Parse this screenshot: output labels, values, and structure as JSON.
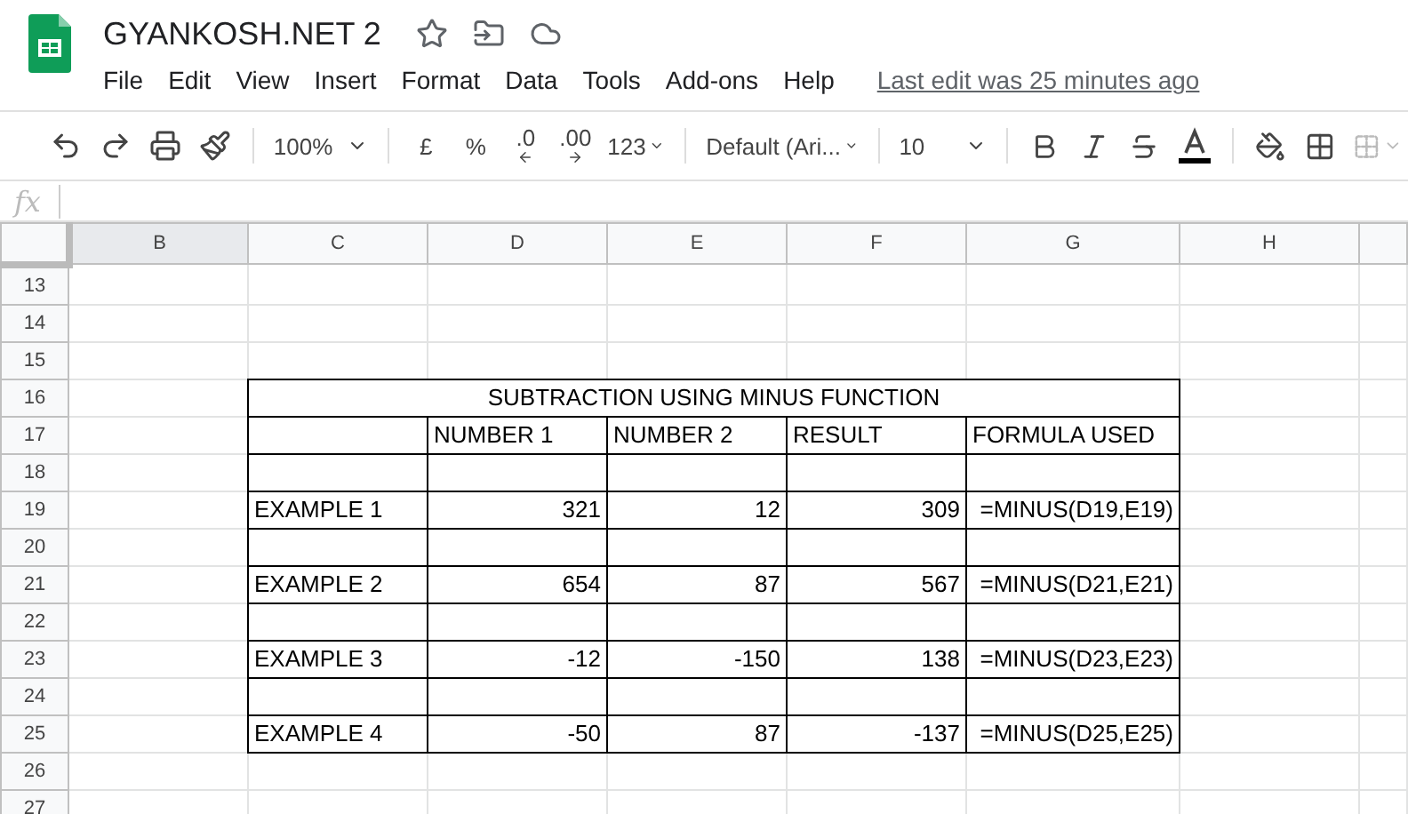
{
  "document": {
    "title": "GYANKOSH.NET 2",
    "menu": [
      "File",
      "Edit",
      "View",
      "Insert",
      "Format",
      "Data",
      "Tools",
      "Add-ons",
      "Help"
    ],
    "last_edit": "Last edit was 25 minutes ago"
  },
  "toolbar": {
    "zoom": "100%",
    "currency": "£",
    "percent": "%",
    "decrease_decimals": ".0",
    "increase_decimals": ".00",
    "number_format": "123",
    "font": "Default (Ari...",
    "font_size": "10",
    "merge_disabled": true
  },
  "formula_bar": {
    "label": "fx"
  },
  "sheet": {
    "columns": [
      {
        "label": "B",
        "selected": true
      },
      {
        "label": "C",
        "selected": false
      },
      {
        "label": "D",
        "selected": false
      },
      {
        "label": "E",
        "selected": false
      },
      {
        "label": "F",
        "selected": false
      },
      {
        "label": "G",
        "selected": false
      },
      {
        "label": "H",
        "selected": false
      }
    ],
    "rows": [
      {
        "number": "13",
        "kind": "blank"
      },
      {
        "number": "14",
        "kind": "blank"
      },
      {
        "number": "15",
        "kind": "blank"
      },
      {
        "number": "16",
        "kind": "title",
        "title": "SUBTRACTION USING MINUS FUNCTION"
      },
      {
        "number": "17",
        "kind": "header",
        "headings": [
          "NUMBER 1",
          "NUMBER 2",
          "RESULT",
          "FORMULA USED"
        ]
      },
      {
        "number": "18",
        "kind": "gap"
      },
      {
        "number": "19",
        "kind": "example",
        "label": "EXAMPLE 1",
        "values": [
          "321",
          "12",
          "309"
        ],
        "formula": "=MINUS(D19,E19)"
      },
      {
        "number": "20",
        "kind": "gap"
      },
      {
        "number": "21",
        "kind": "example",
        "label": "EXAMPLE 2",
        "values": [
          "654",
          "87",
          "567"
        ],
        "formula": "=MINUS(D21,E21)"
      },
      {
        "number": "22",
        "kind": "gap"
      },
      {
        "number": "23",
        "kind": "example",
        "label": "EXAMPLE 3",
        "values": [
          "-12",
          "-150",
          "138"
        ],
        "formula": "=MINUS(D23,E23)"
      },
      {
        "number": "24",
        "kind": "gap"
      },
      {
        "number": "25",
        "kind": "example",
        "label": "EXAMPLE 4",
        "values": [
          "-50",
          "87",
          "-137"
        ],
        "formula": "=MINUS(D25,E25)"
      },
      {
        "number": "26",
        "kind": "blank"
      },
      {
        "number": "27",
        "kind": "blank"
      }
    ]
  }
}
